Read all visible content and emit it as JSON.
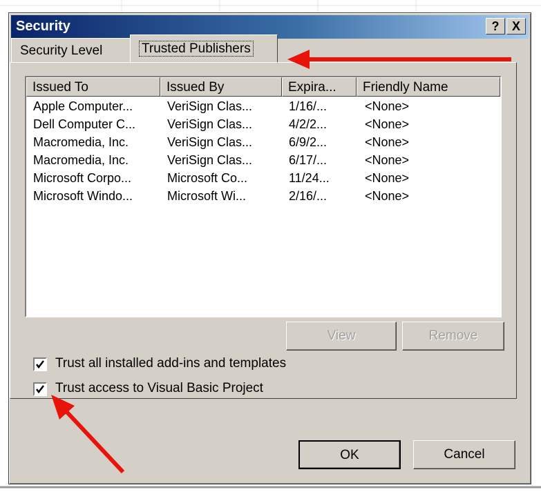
{
  "dialog": {
    "title": "Security",
    "help_button": "?",
    "close_button": "X"
  },
  "tabs": [
    {
      "label": "Security Level"
    },
    {
      "label": "Trusted Publishers"
    }
  ],
  "publishers_table": {
    "columns": [
      "Issued To",
      "Issued By",
      "Expira...",
      "Friendly Name"
    ],
    "rows": [
      [
        "Apple Computer...",
        "VeriSign Clas...",
        "1/16/...",
        "<None>"
      ],
      [
        "Dell Computer C...",
        "VeriSign Clas...",
        "4/2/2...",
        "<None>"
      ],
      [
        "Macromedia, Inc.",
        "VeriSign Clas...",
        "6/9/2...",
        "<None>"
      ],
      [
        "Macromedia, Inc.",
        "VeriSign Clas...",
        "6/17/...",
        "<None>"
      ],
      [
        "Microsoft Corpo...",
        "Microsoft Co...",
        "11/24...",
        "<None>"
      ],
      [
        "Microsoft Windo...",
        "Microsoft Wi...",
        "2/16/...",
        "<None>"
      ]
    ]
  },
  "buttons": {
    "view": "View",
    "remove": "Remove",
    "ok": "OK",
    "cancel": "Cancel"
  },
  "checkboxes": [
    {
      "label": "Trust all installed add-ins and templates",
      "checked": true
    },
    {
      "label": "Trust access to Visual Basic Project",
      "checked": true
    }
  ],
  "colors": {
    "titlebar_start": "#0a246a",
    "titlebar_end": "#a6caf0",
    "dialog_face": "#d4d0c8",
    "annotation_arrow": "#e8140c"
  },
  "icons": [
    "help-icon",
    "close-icon",
    "checkmark-icon",
    "annotation-arrow"
  ]
}
